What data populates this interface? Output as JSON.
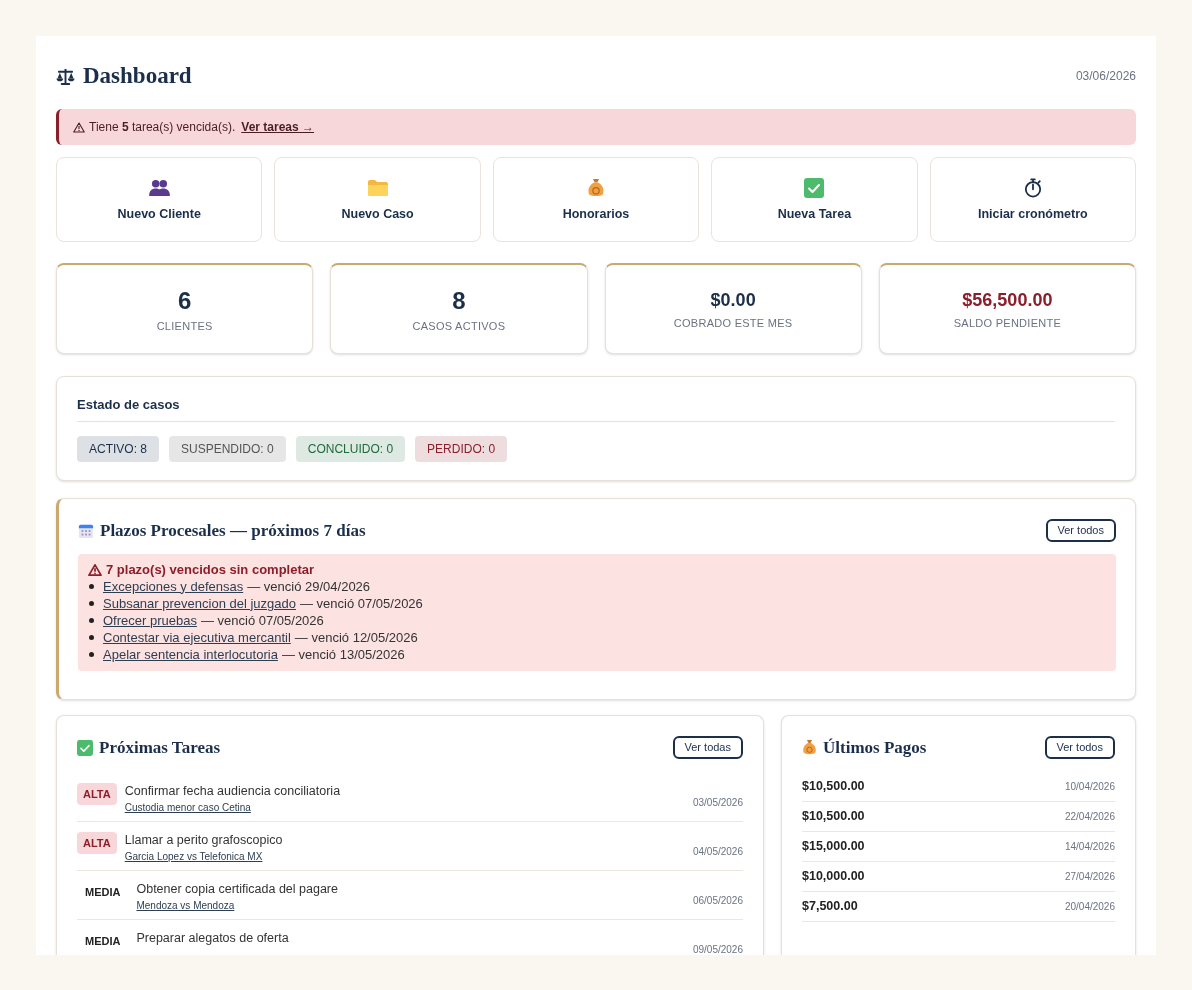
{
  "header": {
    "title": "Dashboard",
    "date": "03/06/2026"
  },
  "alert": {
    "text": "Tiene **5** tarea(s) vencida(s).",
    "link": "Ver tareas →"
  },
  "quick_actions": [
    {
      "label": "Nuevo Cliente"
    },
    {
      "label": "Nuevo Caso"
    },
    {
      "label": "Honorarios"
    },
    {
      "label": "Nueva Tarea"
    },
    {
      "label": "Iniciar cronómetro"
    }
  ],
  "stats": [
    {
      "kind": "count",
      "value": "6",
      "label": "CLIENTES",
      "color": "#1b2f4b"
    },
    {
      "kind": "count",
      "value": "8",
      "label": "CASOS ACTIVOS",
      "color": "#1b2f4b"
    },
    {
      "kind": "amount",
      "value": "$0.00",
      "label": "COBRADO ESTE MES",
      "color": "#1b2f4b"
    },
    {
      "kind": "amount",
      "value": "$56,500.00",
      "label": "SALDO PENDIENTE",
      "color": "#8b1e2b"
    }
  ],
  "case_status": {
    "title": "Estado de casos",
    "badges": [
      {
        "label": "ACTIVO: 8",
        "color": "#1b2f4b"
      },
      {
        "label": "SUSPENDIDO: 0",
        "color": "#555555"
      },
      {
        "label": "CONCLUIDO: 0",
        "color": "#1e6b3a"
      },
      {
        "label": "PERDIDO: 0",
        "color": "#8b1e2b"
      }
    ]
  },
  "deadlines": {
    "title": "Plazos Procesales — próximos 7 días",
    "button": "Ver todos",
    "overdue": {
      "title": "7 plazo(s) vencidos sin completar",
      "items": [
        {
          "name": "Excepciones y defensas",
          "due": "— venció 29/04/2026"
        },
        {
          "name": "Subsanar prevencion del juzgado",
          "due": "— venció 07/05/2026"
        },
        {
          "name": "Ofrecer pruebas",
          "due": "— venció 07/05/2026"
        },
        {
          "name": "Contestar via ejecutiva mercantil",
          "due": "— venció 12/05/2026"
        },
        {
          "name": "Apelar sentencia interlocutoria",
          "due": "— venció 13/05/2026"
        }
      ]
    }
  },
  "tasks": {
    "title": "Próximas Tareas",
    "button": "Ver todas",
    "items": [
      {
        "kind": "high",
        "priority": "ALTA",
        "title": "Confirmar fecha audiencia conciliatoria",
        "case": "Custodia menor caso Cetina",
        "date": "03/05/2026"
      },
      {
        "kind": "high",
        "priority": "ALTA",
        "title": "Llamar a perito grafoscopico",
        "case": "Garcia Lopez vs Telefonica MX",
        "date": "04/05/2026"
      },
      {
        "kind": "medium",
        "priority": "MEDIA",
        "title": "Obtener copia certificada del pagare",
        "case": "Mendoza vs Mendoza",
        "date": "06/05/2026"
      },
      {
        "kind": "medium",
        "priority": "MEDIA",
        "title": "Preparar alegatos de oferta",
        "date": "09/05/2026"
      }
    ]
  },
  "payments": {
    "title": "Últimos Pagos",
    "button": "Ver todos",
    "items": [
      {
        "amount": "$10,500.00",
        "date": "10/04/2026"
      },
      {
        "amount": "$10,500.00",
        "date": "22/04/2026"
      },
      {
        "amount": "$15,000.00",
        "date": "14/04/2026"
      },
      {
        "amount": "$10,000.00",
        "date": "27/04/2026"
      },
      {
        "amount": "$7,500.00",
        "date": "20/04/2026"
      }
    ]
  }
}
